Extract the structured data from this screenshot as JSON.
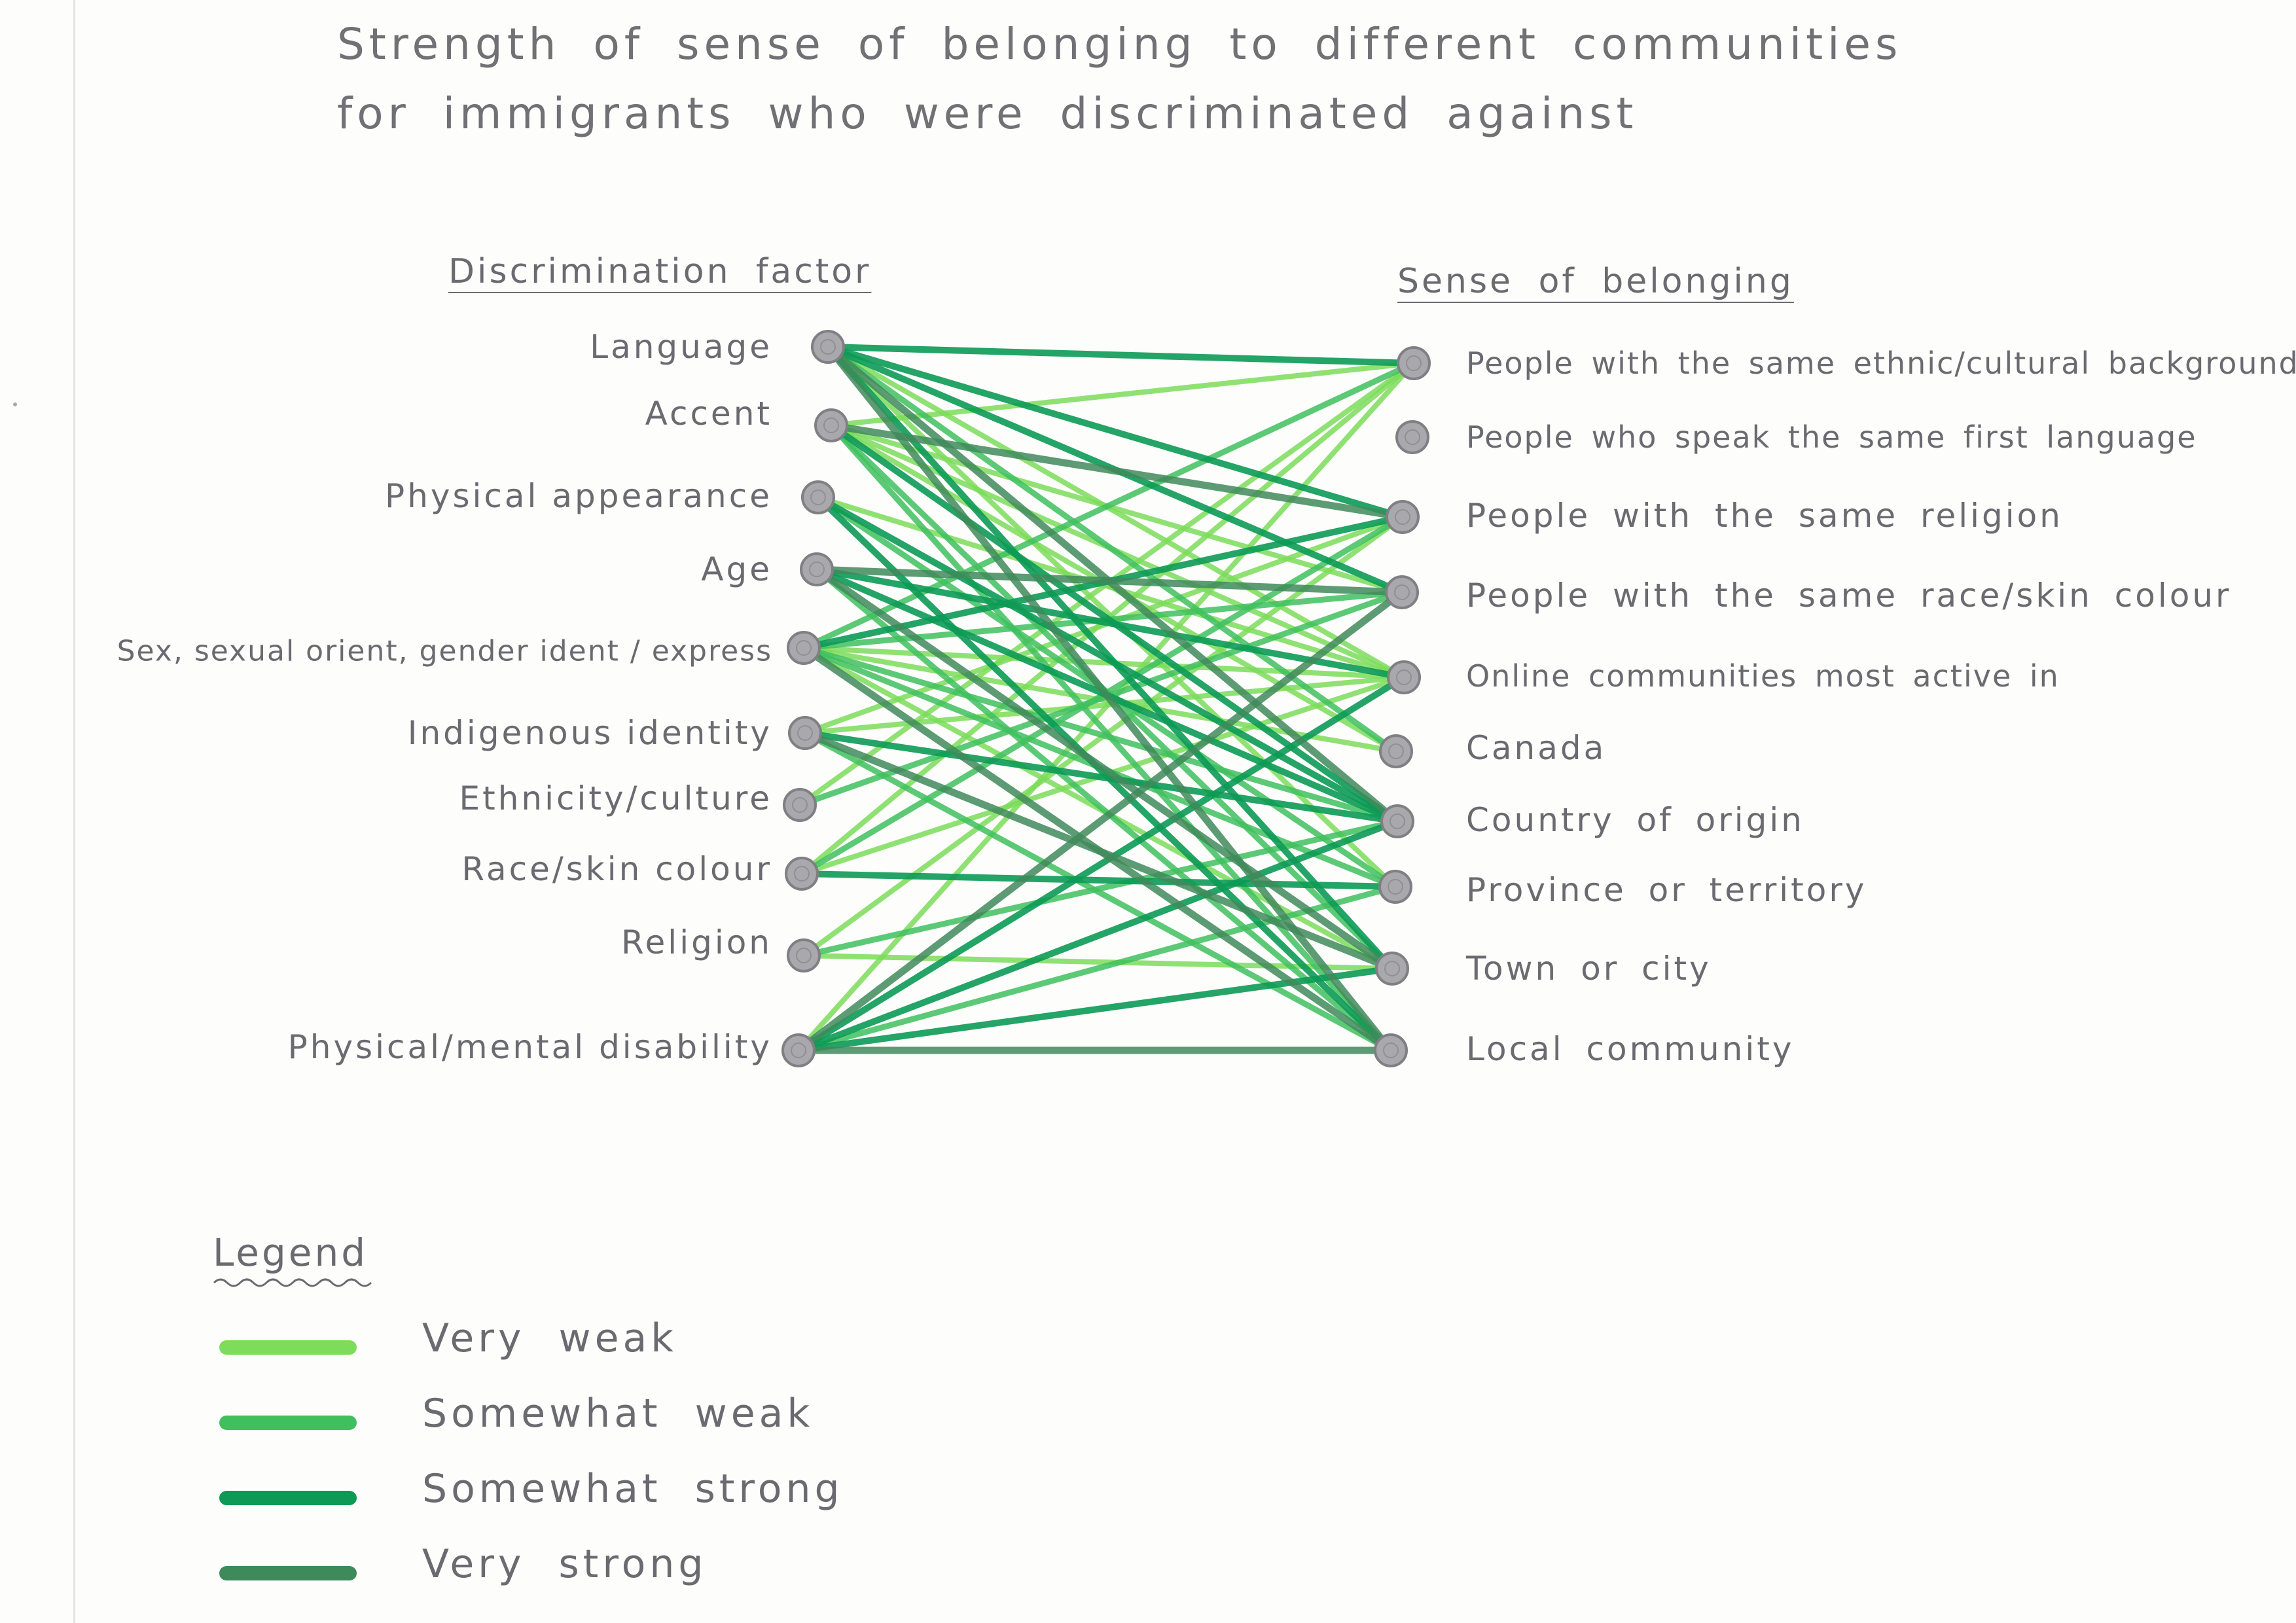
{
  "title": {
    "line1": "Strength of sense of belonging to different communities",
    "line2": "for immigrants who were discriminated against"
  },
  "left_header": "Discrimination factor",
  "right_header": "Sense of belonging",
  "factors": [
    "Language",
    "Accent",
    "Physical appearance",
    "Age",
    "Sex, sexual orient, gender ident / express",
    "Indigenous identity",
    "Ethnicity/culture",
    "Race/skin colour",
    "Religion",
    "Physical/mental disability"
  ],
  "belongings": [
    "People with the same ethnic/cultural background",
    "People who speak the same first language",
    "People with the same religion",
    "People with the same race/skin colour",
    "Online communities most active in",
    "Canada",
    "Country of origin",
    "Province or territory",
    "Town or city",
    "Local community"
  ],
  "legend": {
    "title": "Legend",
    "items": [
      {
        "label": "Very weak",
        "color": "#7ddc5a"
      },
      {
        "label": "Somewhat weak",
        "color": "#3fbf5e"
      },
      {
        "label": "Somewhat strong",
        "color": "#0c9a55"
      },
      {
        "label": "Very strong",
        "color": "#3f8a5a"
      }
    ]
  },
  "colors": {
    "node": "#a9a9ad",
    "node_ring": "#7f7f84"
  },
  "connections": [
    {
      "from": 0,
      "to": 0,
      "strength": 2
    },
    {
      "from": 0,
      "to": 2,
      "strength": 2
    },
    {
      "from": 0,
      "to": 3,
      "strength": 2
    },
    {
      "from": 0,
      "to": 4,
      "strength": 0
    },
    {
      "from": 0,
      "to": 5,
      "strength": 1
    },
    {
      "from": 0,
      "to": 6,
      "strength": 3
    },
    {
      "from": 0,
      "to": 7,
      "strength": 0
    },
    {
      "from": 0,
      "to": 8,
      "strength": 2
    },
    {
      "from": 0,
      "to": 9,
      "strength": 3
    },
    {
      "from": 1,
      "to": 0,
      "strength": 0
    },
    {
      "from": 1,
      "to": 2,
      "strength": 3
    },
    {
      "from": 1,
      "to": 3,
      "strength": 0
    },
    {
      "from": 1,
      "to": 4,
      "strength": 0
    },
    {
      "from": 1,
      "to": 5,
      "strength": 0
    },
    {
      "from": 1,
      "to": 6,
      "strength": 2
    },
    {
      "from": 1,
      "to": 8,
      "strength": 1
    },
    {
      "from": 1,
      "to": 9,
      "strength": 1
    },
    {
      "from": 2,
      "to": 4,
      "strength": 0
    },
    {
      "from": 2,
      "to": 6,
      "strength": 2
    },
    {
      "from": 2,
      "to": 7,
      "strength": 1
    },
    {
      "from": 2,
      "to": 9,
      "strength": 2
    },
    {
      "from": 3,
      "to": 3,
      "strength": 3
    },
    {
      "from": 3,
      "to": 4,
      "strength": 2
    },
    {
      "from": 3,
      "to": 6,
      "strength": 2
    },
    {
      "from": 3,
      "to": 8,
      "strength": 3
    },
    {
      "from": 3,
      "to": 9,
      "strength": 1
    },
    {
      "from": 4,
      "to": 0,
      "strength": 1
    },
    {
      "from": 4,
      "to": 2,
      "strength": 2
    },
    {
      "from": 4,
      "to": 3,
      "strength": 1
    },
    {
      "from": 4,
      "to": 4,
      "strength": 0
    },
    {
      "from": 4,
      "to": 5,
      "strength": 0
    },
    {
      "from": 4,
      "to": 6,
      "strength": 1
    },
    {
      "from": 4,
      "to": 7,
      "strength": 1
    },
    {
      "from": 4,
      "to": 8,
      "strength": 0
    },
    {
      "from": 4,
      "to": 9,
      "strength": 3
    },
    {
      "from": 5,
      "to": 2,
      "strength": 0
    },
    {
      "from": 5,
      "to": 4,
      "strength": 0
    },
    {
      "from": 5,
      "to": 6,
      "strength": 2
    },
    {
      "from": 5,
      "to": 8,
      "strength": 3
    },
    {
      "from": 5,
      "to": 9,
      "strength": 1
    },
    {
      "from": 6,
      "to": 0,
      "strength": 0
    },
    {
      "from": 6,
      "to": 3,
      "strength": 1
    },
    {
      "from": 7,
      "to": 0,
      "strength": 0
    },
    {
      "from": 7,
      "to": 2,
      "strength": 1
    },
    {
      "from": 7,
      "to": 4,
      "strength": 0
    },
    {
      "from": 7,
      "to": 7,
      "strength": 2
    },
    {
      "from": 8,
      "to": 2,
      "strength": 0
    },
    {
      "from": 8,
      "to": 6,
      "strength": 1
    },
    {
      "from": 8,
      "to": 8,
      "strength": 0
    },
    {
      "from": 9,
      "to": 0,
      "strength": 0
    },
    {
      "from": 9,
      "to": 3,
      "strength": 3
    },
    {
      "from": 9,
      "to": 4,
      "strength": 2
    },
    {
      "from": 9,
      "to": 6,
      "strength": 2
    },
    {
      "from": 9,
      "to": 7,
      "strength": 1
    },
    {
      "from": 9,
      "to": 8,
      "strength": 2
    },
    {
      "from": 9,
      "to": 9,
      "strength": 3
    }
  ]
}
